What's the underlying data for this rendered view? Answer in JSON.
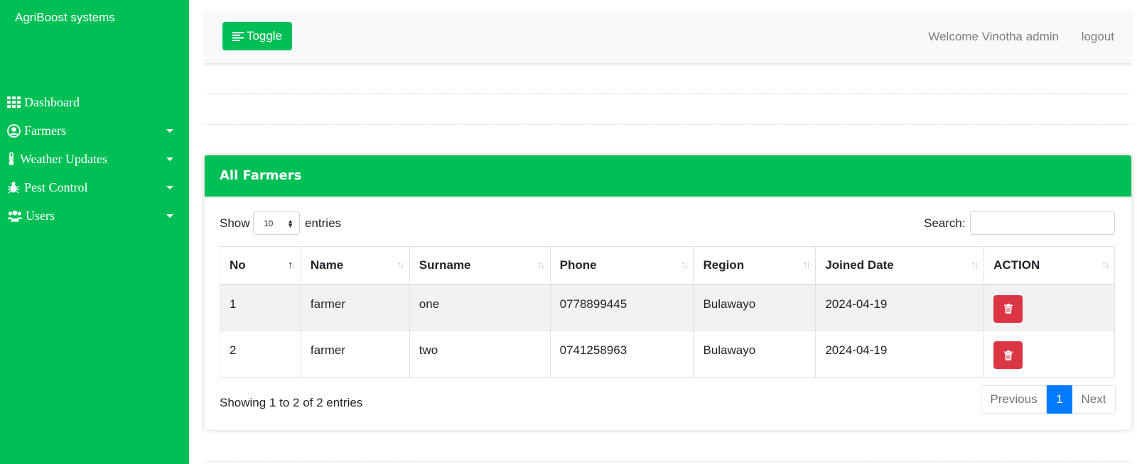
{
  "app": {
    "brand": "AgriBoost systems"
  },
  "sidebar": {
    "items": [
      {
        "label": "Dashboard",
        "icon": "grid-icon",
        "has_caret": false
      },
      {
        "label": "Farmers",
        "icon": "user-circle-icon",
        "has_caret": true
      },
      {
        "label": "Weather Updates",
        "icon": "thermometer-icon",
        "has_caret": true
      },
      {
        "label": "Pest Control",
        "icon": "bug-icon",
        "has_caret": true
      },
      {
        "label": "Users",
        "icon": "users-icon",
        "has_caret": true
      }
    ]
  },
  "topbar": {
    "toggle_label": "Toggle",
    "welcome": "Welcome Vinotha admin",
    "logout": "logout"
  },
  "card": {
    "title": "All Farmers",
    "length": {
      "show": "Show",
      "value": "10",
      "entries": "entries"
    },
    "search": {
      "label": "Search:",
      "value": ""
    },
    "columns": [
      "No",
      "Name",
      "Surname",
      "Phone",
      "Region",
      "Joined Date",
      "ACTION"
    ],
    "rows": [
      {
        "no": "1",
        "name": "farmer",
        "surname": "one",
        "phone": "0778899445",
        "region": "Bulawayo",
        "joined": "2024-04-19"
      },
      {
        "no": "2",
        "name": "farmer",
        "surname": "two",
        "phone": "0741258963",
        "region": "Bulawayo",
        "joined": "2024-04-19"
      }
    ],
    "info": "Showing 1 to 2 of 2 entries",
    "pagination": {
      "previous": "Previous",
      "current": "1",
      "next": "Next"
    }
  },
  "colors": {
    "brand_green": "#00bf55",
    "delete_red": "#dc3545",
    "page_active_blue": "#007bff"
  }
}
